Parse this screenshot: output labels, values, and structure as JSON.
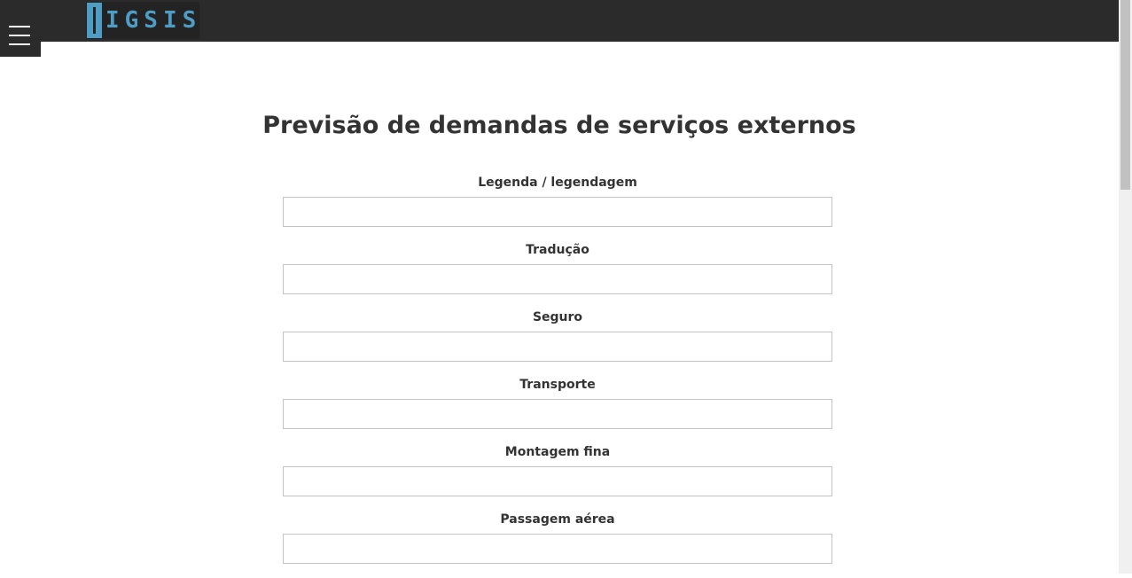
{
  "header": {
    "logo_text": "IGSIS",
    "menu_icon": "hamburger-menu-icon"
  },
  "page": {
    "title": "Previsão de demandas de serviços externos"
  },
  "form": {
    "fields": [
      {
        "label": "Legenda / legendagem",
        "value": ""
      },
      {
        "label": "Tradução",
        "value": ""
      },
      {
        "label": "Seguro",
        "value": ""
      },
      {
        "label": "Transporte",
        "value": ""
      },
      {
        "label": "Montagem fina",
        "value": ""
      },
      {
        "label": "Passagem aérea",
        "value": ""
      }
    ]
  },
  "colors": {
    "topbar": "#2b2b2b",
    "logo_accent": "#4e9dc4",
    "text": "#333333",
    "input_border": "#c4c4c4"
  }
}
